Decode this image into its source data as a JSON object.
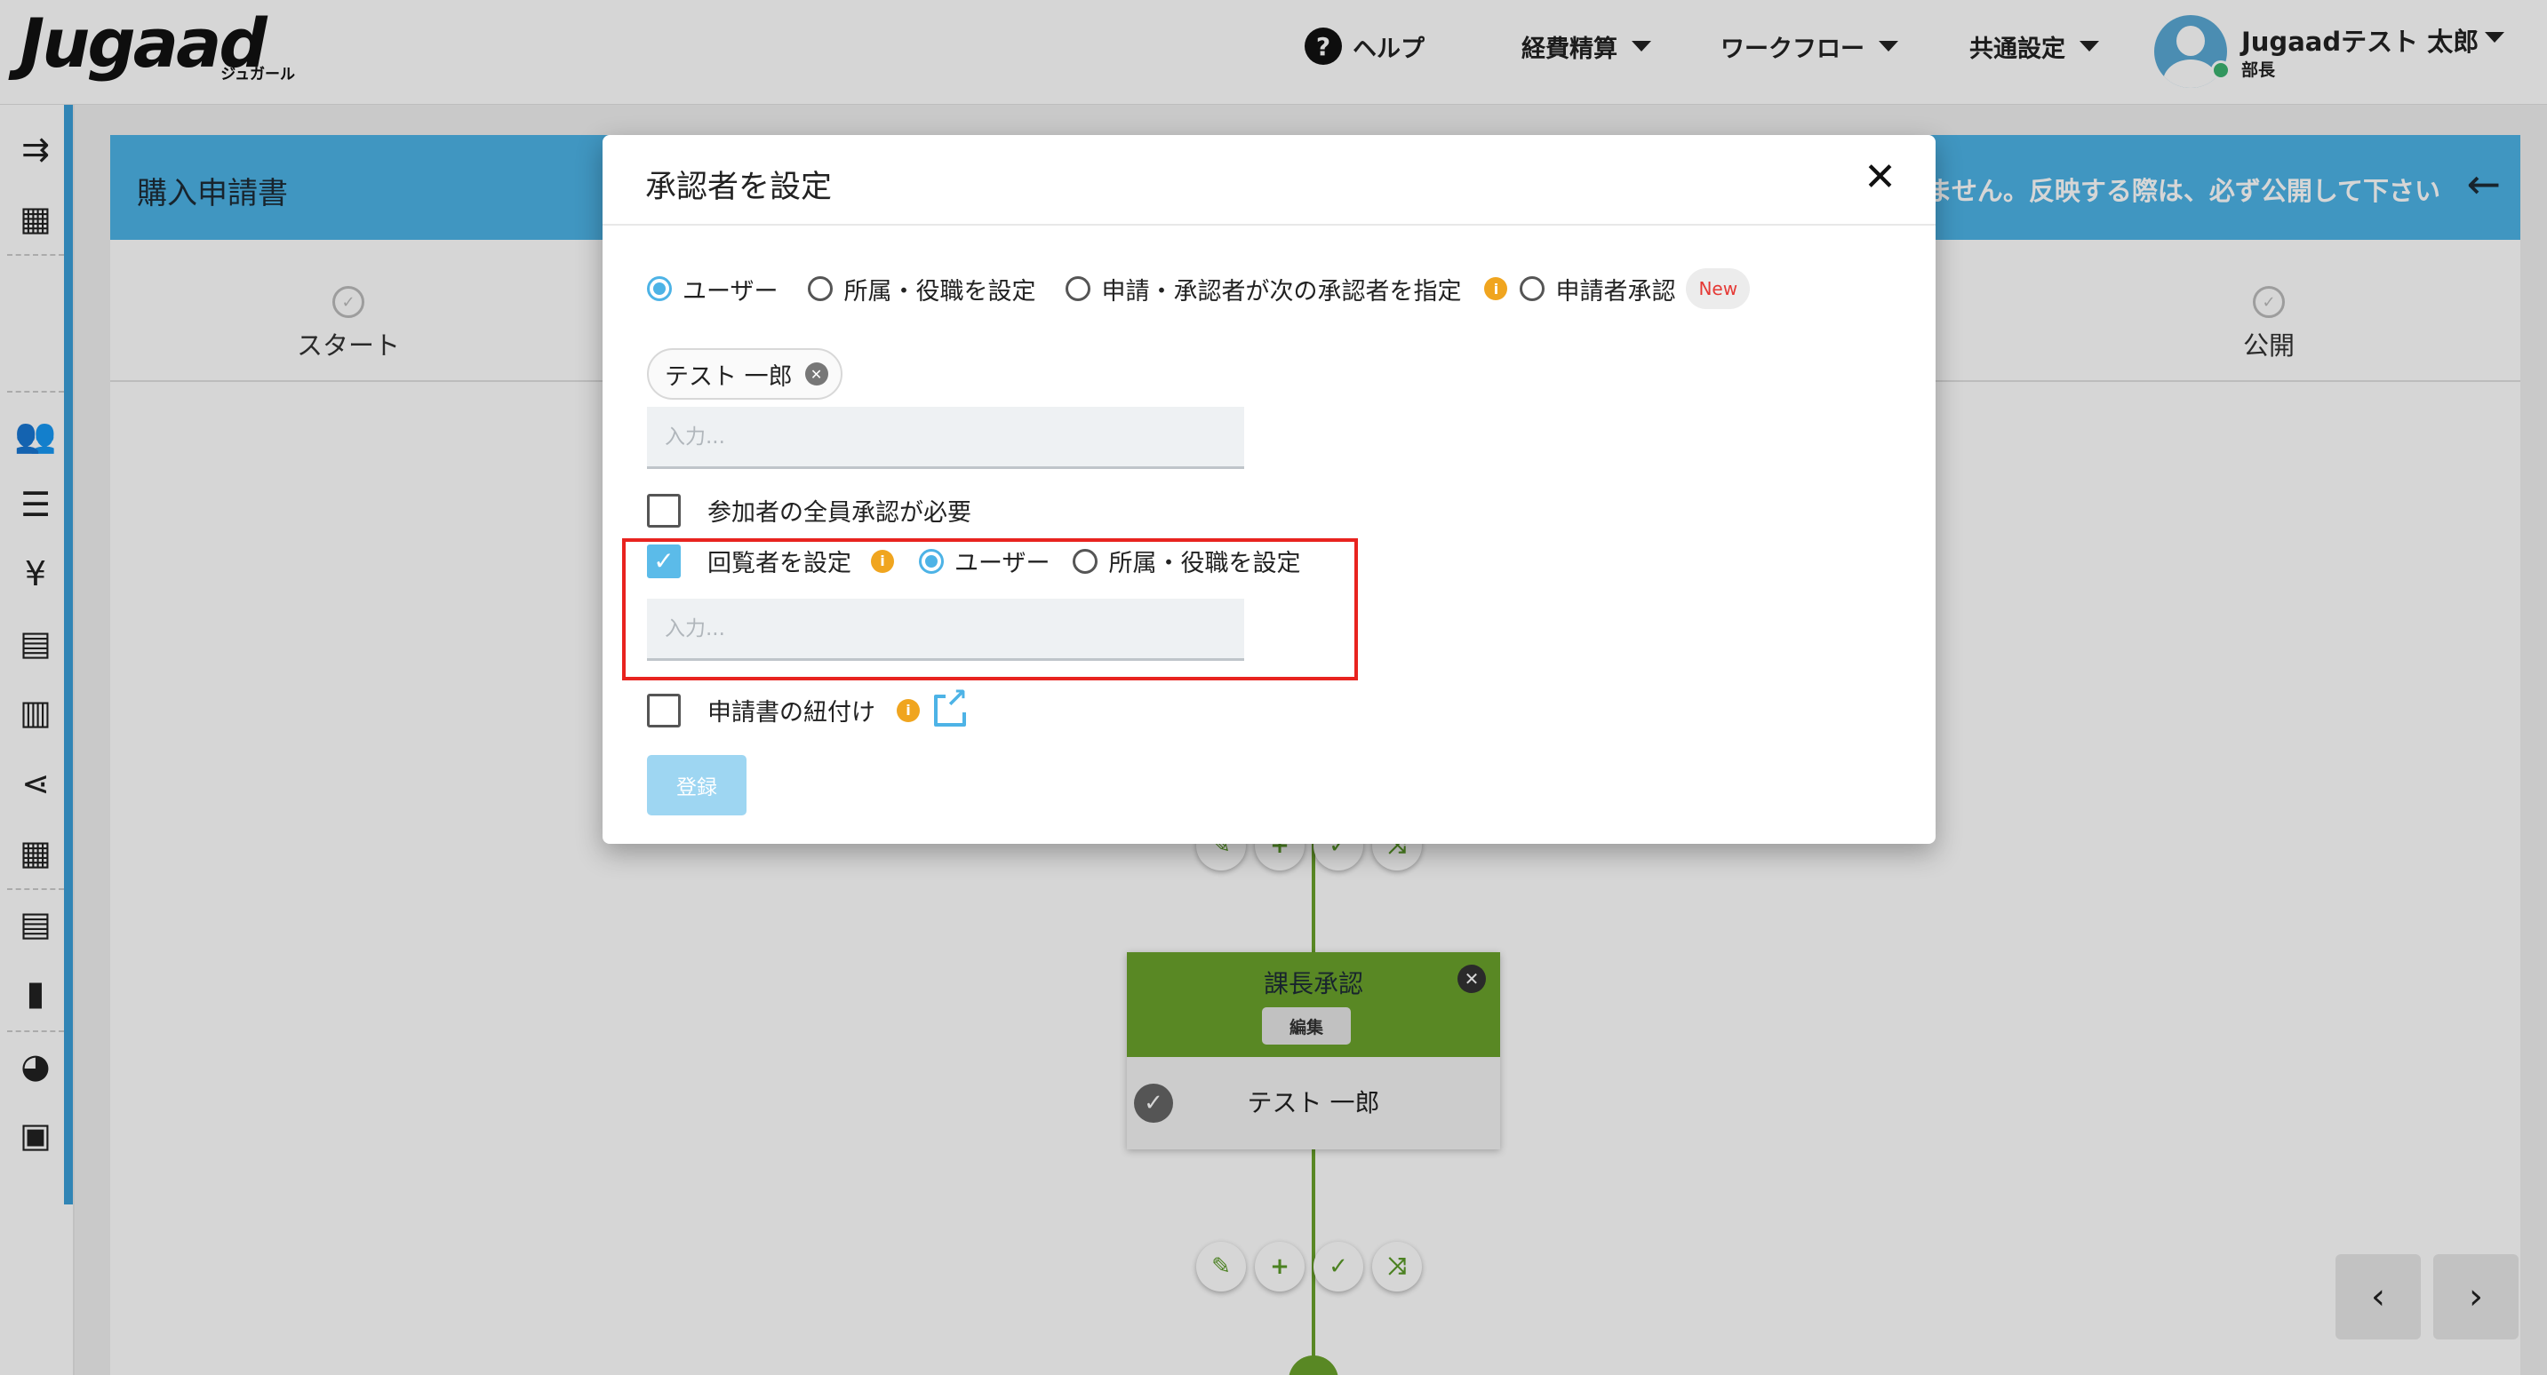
{
  "brand": {
    "logo": "Jugaad",
    "logo_sub": "ジュガール"
  },
  "header": {
    "help": "ヘルプ",
    "nav": [
      "経費精算",
      "ワークフロー",
      "共通設定"
    ],
    "user_name": "Jugaadテスト 太郎",
    "user_role": "部長"
  },
  "sidebar": {
    "icons": [
      "menu-collapse-icon",
      "building-icon",
      "users-icon",
      "list-icon",
      "yen-icon",
      "document-list-icon",
      "receipt-icon",
      "share-icon",
      "table-icon",
      "library-icon",
      "file-icon",
      "palette-icon",
      "wallet-icon"
    ]
  },
  "page": {
    "title": "購入申請書",
    "warning": "ません。反映する際は、必ず公開して下さい",
    "steps": [
      "スタート",
      "公開"
    ]
  },
  "flow_node": {
    "title": "課長承認",
    "edit_label": "編集",
    "user": "テスト 一郎"
  },
  "modal": {
    "title": "承認者を設定",
    "approver_type_options": [
      "ユーザー",
      "所属・役職を設定",
      "申請・承認者が次の承認者を指定",
      "申請者承認"
    ],
    "approver_type_selected": "ユーザー",
    "new_badge": "New",
    "selected_user_chip": "テスト 一郎",
    "input_placeholder": "入力...",
    "all_approval_label": "参加者の全員承認が必要",
    "all_approval_checked": false,
    "viewer_label": "回覧者を設定",
    "viewer_checked": true,
    "viewer_type_options": [
      "ユーザー",
      "所属・役職を設定"
    ],
    "viewer_type_selected": "ユーザー",
    "viewer_input_placeholder": "入力...",
    "link_application_label": "申請書の紐付け",
    "link_application_checked": false,
    "submit_label": "登録"
  },
  "colors": {
    "accent": "#4db3e6",
    "flow_green": "#6aa32b",
    "info": "#f0a51f",
    "highlight": "#e8231f"
  }
}
